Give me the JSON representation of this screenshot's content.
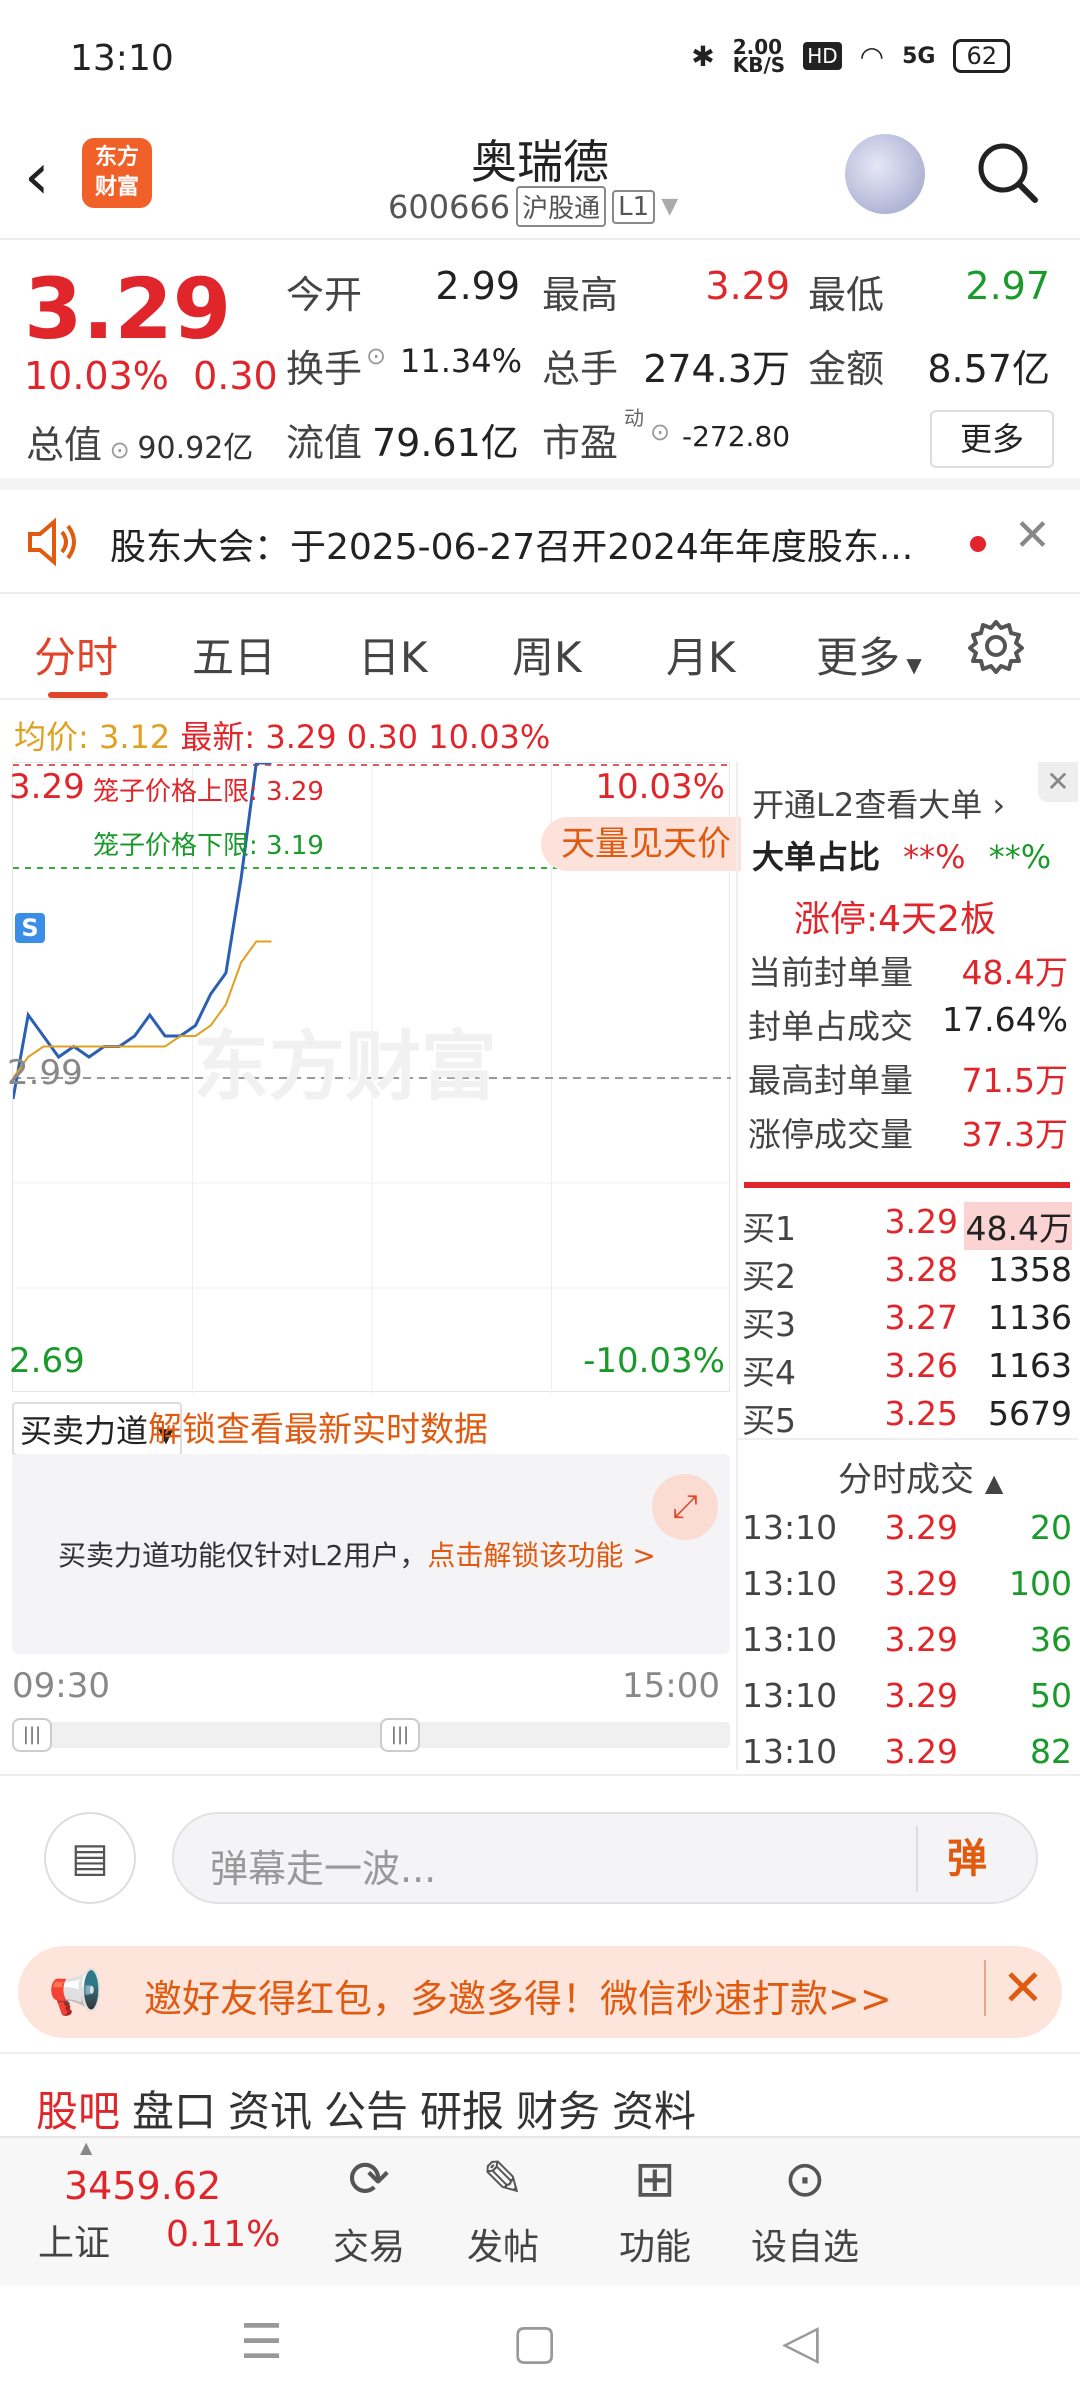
{
  "status": {
    "time": "13:10",
    "speed": "2.00\nKB/S",
    "hd": "HD",
    "signal": "5G",
    "battery": "62"
  },
  "header": {
    "back": "‹",
    "logo_line1": "东方",
    "logo_line2": "财富",
    "name": "奥瑞德",
    "code": "600666",
    "tag1": "沪股通",
    "tag2": "L1"
  },
  "quote": {
    "price": "3.29",
    "pct": "10.03%",
    "chg": "0.30",
    "open_label": "今开",
    "open": "2.99",
    "high_label": "最高",
    "high": "3.29",
    "low_label": "最低",
    "low": "2.97",
    "turnover_label": "换手",
    "turnover": "11.34%",
    "vol_label": "总手",
    "vol": "274.3万",
    "amount_label": "金额",
    "amount": "8.57亿",
    "mcap_label": "总值",
    "mcap": "90.92亿",
    "float_label": "流值",
    "float": "79.61亿",
    "pe_label": "市盈",
    "pe_sup": "动",
    "pe": "-272.80",
    "more": "更多"
  },
  "notice": {
    "text": "股东大会：于2025-06-27召开2024年年度股东..."
  },
  "tabs": [
    "分时",
    "五日",
    "日K",
    "周K",
    "月K",
    "更多"
  ],
  "avgline": {
    "avg_label": "均价:",
    "avg": "3.12",
    "latest_label": "最新:",
    "latest": "3.29",
    "chg": "0.30",
    "pct": "10.03%"
  },
  "chart": {
    "top_price": "3.29",
    "top_pct": "10.03%",
    "upper_limit": "笼子价格上限: 3.29",
    "lower_limit": "笼子价格下限: 3.19",
    "mid_price": "2.99",
    "bottom_price": "2.69",
    "bottom_pct": "-10.03%",
    "badge": "天量见天价",
    "watermark": "东方财富",
    "s_marker": "S"
  },
  "chart_data": {
    "type": "line",
    "ylim": [
      2.69,
      3.29
    ],
    "series": [
      {
        "name": "",
        "values": [
          2.97,
          3.05,
          3.03,
          3.01,
          3.02,
          3.01,
          3.02,
          3.02,
          3.03,
          3.05,
          3.03,
          3.03,
          3.04,
          3.07,
          3.09,
          3.18,
          3.29,
          3.29
        ]
      },
      {
        "name": "",
        "values": [
          2.99,
          3.01,
          3.02,
          3.02,
          3.02,
          3.02,
          3.02,
          3.02,
          3.02,
          3.02,
          3.02,
          3.03,
          3.03,
          3.04,
          3.06,
          3.1,
          3.12,
          3.12
        ]
      }
    ]
  },
  "rpanel": {
    "l2": "开通L2查看大单 ›",
    "big_label": "大单占比",
    "big_buy": "**%",
    "big_sell": "**%",
    "limit_label": "涨停:",
    "limit_val": "4天2板",
    "rows": [
      {
        "label": "当前封单量",
        "value": "48.4万"
      },
      {
        "label": "封单占成交",
        "value": "17.64%"
      },
      {
        "label": "最高封单量",
        "value": "71.5万"
      },
      {
        "label": "涨停成交量",
        "value": "37.3万"
      }
    ],
    "orderbook": [
      {
        "label": "买1",
        "price": "3.29",
        "vol": "48.4万"
      },
      {
        "label": "买2",
        "price": "3.28",
        "vol": "1358"
      },
      {
        "label": "买3",
        "price": "3.27",
        "vol": "1136"
      },
      {
        "label": "买4",
        "price": "3.26",
        "vol": "1163"
      },
      {
        "label": "买5",
        "price": "3.25",
        "vol": "5679"
      }
    ],
    "ticks_title": "分时成交",
    "ticks": [
      {
        "time": "13:10",
        "price": "3.29",
        "vol": "20"
      },
      {
        "time": "13:10",
        "price": "3.29",
        "vol": "100"
      },
      {
        "time": "13:10",
        "price": "3.29",
        "vol": "36"
      },
      {
        "time": "13:10",
        "price": "3.29",
        "vol": "50"
      },
      {
        "time": "13:10",
        "price": "3.29",
        "vol": "82"
      }
    ]
  },
  "mm": {
    "select": "买卖力道",
    "link": "解锁查看最新实时数据",
    "text": "买卖力道功能仅针对L2用户，",
    "unlock": "点击解锁该功能 >"
  },
  "time_axis": {
    "start": "09:30",
    "end": "15:00"
  },
  "comment": {
    "placeholder": "弹幕走一波...",
    "danmu": "弹"
  },
  "banner": {
    "text": "邀好友得红包，多邀多得！微信秒速打款>>"
  },
  "btabs": [
    "股吧",
    "盘口",
    "资讯",
    "公告",
    "研报",
    "财务",
    "资料"
  ],
  "bnav": {
    "index_val": "3459.62",
    "index_name": "上证",
    "index_pct": "0.11%",
    "items": [
      "交易",
      "发帖",
      "功能",
      "设自选"
    ]
  }
}
